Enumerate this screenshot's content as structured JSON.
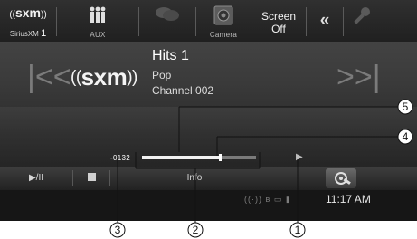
{
  "top_bar": {
    "siriusxm": {
      "logo_text": "sxm",
      "label": "SiriusXM",
      "band": "1"
    },
    "aux": {
      "label": "AUX"
    },
    "audio_setup": {
      "label": ""
    },
    "camera": {
      "label": "Camera"
    },
    "screen_off": {
      "line1": "Screen",
      "line2": "Off"
    },
    "collapse_glyph": "«"
  },
  "now_playing": {
    "logo_text": "sxm",
    "title": "Hits 1",
    "genre": "Pop",
    "channel": "Channel 002"
  },
  "progress": {
    "time_left": "-0132",
    "fill_fraction": 0.7,
    "marker_fraction": 0.68
  },
  "bottom_bar": {
    "play_pause_label": "▶/II",
    "info_label": "Info",
    "clock": "11:17 AM"
  },
  "callouts": [
    "1",
    "2",
    "3",
    "4",
    "5"
  ],
  "icons": [
    "siriusxm-logo-icon",
    "aux-people-icon",
    "chat-icon",
    "camera-icon",
    "double-chevron-left-icon",
    "setup-wrench-icon",
    "skip-previous-icon",
    "skip-next-icon",
    "play-icon",
    "stop-icon",
    "antenna-icon",
    "bluetooth-icon",
    "battery-icon",
    "signal-icon"
  ],
  "colors": {
    "background": "#2b2b2b",
    "text": "#ffffff",
    "dim": "#7b7b7b"
  }
}
